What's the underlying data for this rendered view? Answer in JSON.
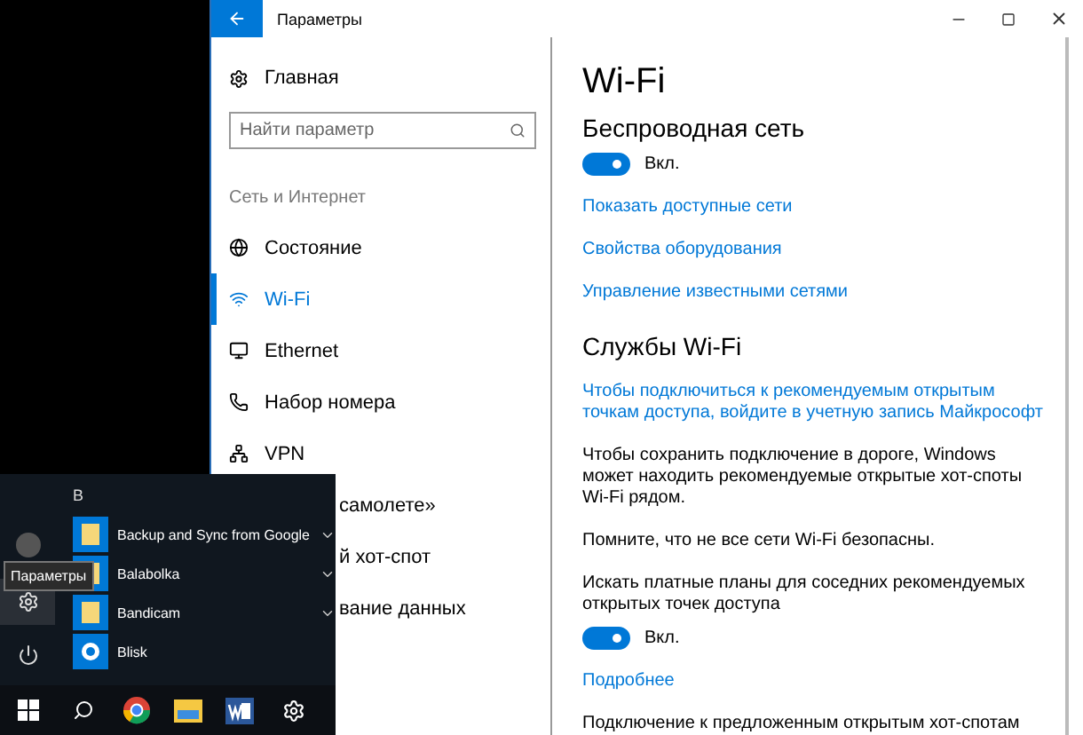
{
  "window": {
    "title": "Параметры"
  },
  "nav": {
    "home": "Главная",
    "search": {
      "placeholder": "Найти параметр"
    },
    "section": "Сеть и Интернет",
    "items": [
      {
        "label": "Состояние",
        "selected": false,
        "kind": "item"
      },
      {
        "label": "Wi-Fi",
        "selected": true,
        "kind": "item"
      },
      {
        "label": "Ethernet",
        "selected": false,
        "kind": "item"
      },
      {
        "label": "Набор номера",
        "selected": false,
        "kind": "item"
      },
      {
        "label": "VPN",
        "selected": false,
        "kind": "item"
      },
      {
        "label": "самолете»",
        "selected": false,
        "kind": "covered"
      },
      {
        "label": "й хот-спот",
        "selected": false,
        "kind": "covered"
      },
      {
        "label": "вание данных",
        "selected": false,
        "kind": "covered"
      }
    ]
  },
  "content": {
    "title": "Wi-Fi",
    "wireless_heading": "Беспроводная сеть",
    "wireless_toggle": {
      "on": true,
      "label": "Вкл."
    },
    "links": [
      "Показать доступные сети",
      "Свойства оборудования",
      "Управление известными сетями"
    ],
    "services_heading": "Службы Wi-Fi",
    "services_link": "Чтобы подключиться к рекомендуемым открытым точкам доступа, войдите в учетную запись Майкрософт",
    "paragraphs": [
      "Чтобы сохранить подключение в дороге, Windows может находить рекомендуемые открытые хот-споты Wi-Fi рядом.",
      "Помните, что не все сети Wi-Fi безопасны."
    ],
    "paid_plans_label": "Искать платные планы для соседних рекомендуемых открытых точек доступа",
    "paid_plans_toggle": {
      "on": true,
      "label": "Вкл."
    },
    "more_link": "Подробнее",
    "suggested_label": "Подключение к предложенным открытым хот-спотам"
  },
  "start_menu": {
    "letter": "B",
    "apps": [
      {
        "name": "Backup and Sync from Google",
        "kind": "folder",
        "expandable": true
      },
      {
        "name": "Balabolka",
        "kind": "folder",
        "expandable": true
      },
      {
        "name": "Bandicam",
        "kind": "folder",
        "expandable": true
      },
      {
        "name": "Blisk",
        "kind": "app",
        "expandable": false
      }
    ],
    "tooltip": "Параметры"
  }
}
